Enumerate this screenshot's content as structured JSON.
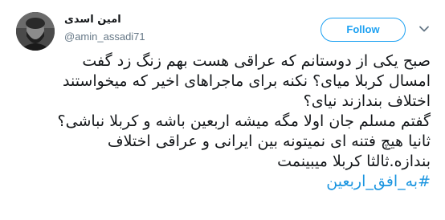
{
  "tweet": {
    "display_name": "امین اسدی",
    "handle": "@amin_assadi71",
    "follow_label": "Follow",
    "lines": [
      "صبح یکی از دوستانم که عراقی هست بهم  زنگ زد گفت",
      "امسال کربلا میای؟ نکنه برای ماجراهای اخیر که میخواستند",
      "اختلاف بندازند نیای؟",
      "گفتم مسلم جان اولا مگه میشه اربعین باشه و کربلا نباشی؟",
      "ثانیا هیچ فتنه ای نمیتونه بین ایرانی و عراقی اختلاف",
      "بندازه.ثالثا کربلا میبینمت"
    ],
    "hashtag": "#به_افق_اربعین"
  },
  "colors": {
    "accent": "#1da1f2",
    "hashtag": "#1b95e0",
    "secondary_text": "#657786",
    "primary_text": "#14171a"
  },
  "icons": {
    "avatar": "user-avatar",
    "menu": "chevron-down-icon"
  }
}
